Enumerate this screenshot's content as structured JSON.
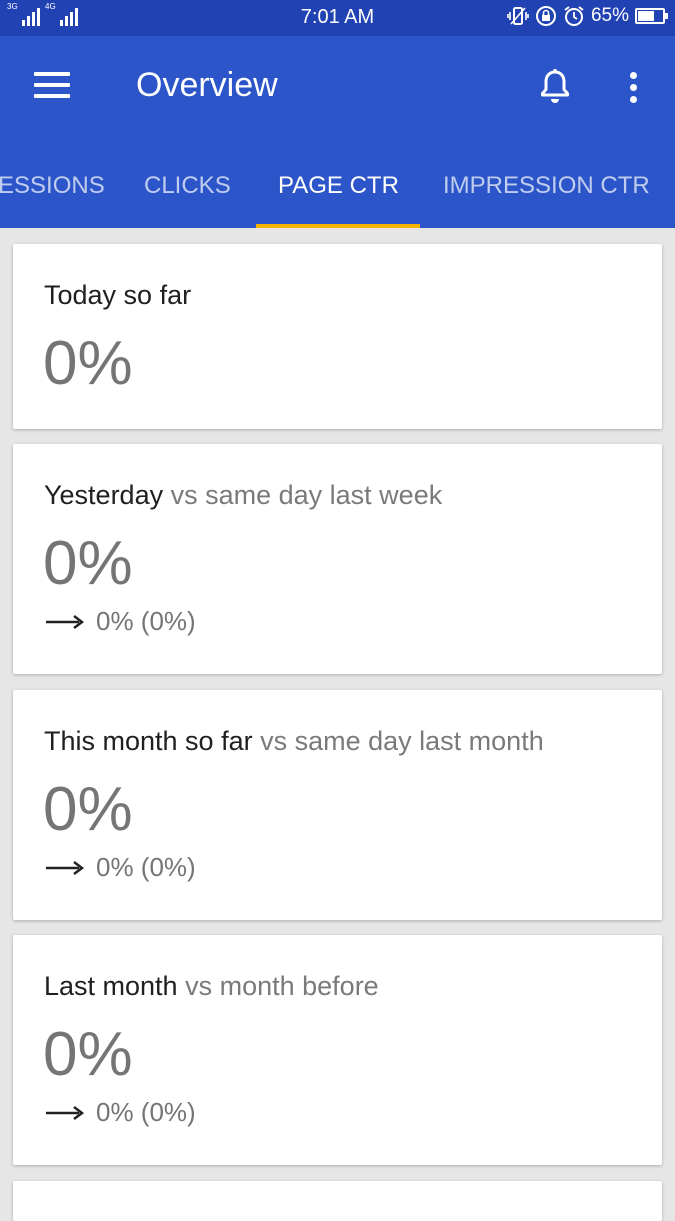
{
  "status_bar": {
    "network_1": "3G",
    "network_2": "4G",
    "time": "7:01 AM",
    "battery": "65%",
    "battery_level": 0.65,
    "icons": [
      "signal-icon",
      "vibrate-icon",
      "rotation-lock-icon",
      "alarm-icon",
      "battery-icon"
    ]
  },
  "app_bar": {
    "title": "Overview",
    "icons": [
      "menu-icon",
      "bell-icon",
      "more-vert-icon"
    ]
  },
  "tabs": [
    {
      "label": "IMPRESSIONS",
      "visible_text": "ESSIONS",
      "active": false
    },
    {
      "label": "CLICKS",
      "active": false
    },
    {
      "label": "PAGE CTR",
      "active": true
    },
    {
      "label": "IMPRESSION CTR",
      "active": false
    }
  ],
  "cards": [
    {
      "heading": "Today so far",
      "subheading": "",
      "value": "0%",
      "change": ""
    },
    {
      "heading": "Yesterday",
      "subheading": "vs same day last week",
      "value": "0%",
      "change": "0% (0%)"
    },
    {
      "heading": "This month so far",
      "subheading": "vs same day last month",
      "value": "0%",
      "change": "0% (0%)"
    },
    {
      "heading": "Last month",
      "subheading": "vs month before",
      "value": "0%",
      "change": "0% (0%)"
    }
  ],
  "colors": {
    "status_bar": "#2142b3",
    "app_bar": "#2b55c8",
    "tab_indicator": "#f4b400",
    "background": "#e6e6e6"
  }
}
